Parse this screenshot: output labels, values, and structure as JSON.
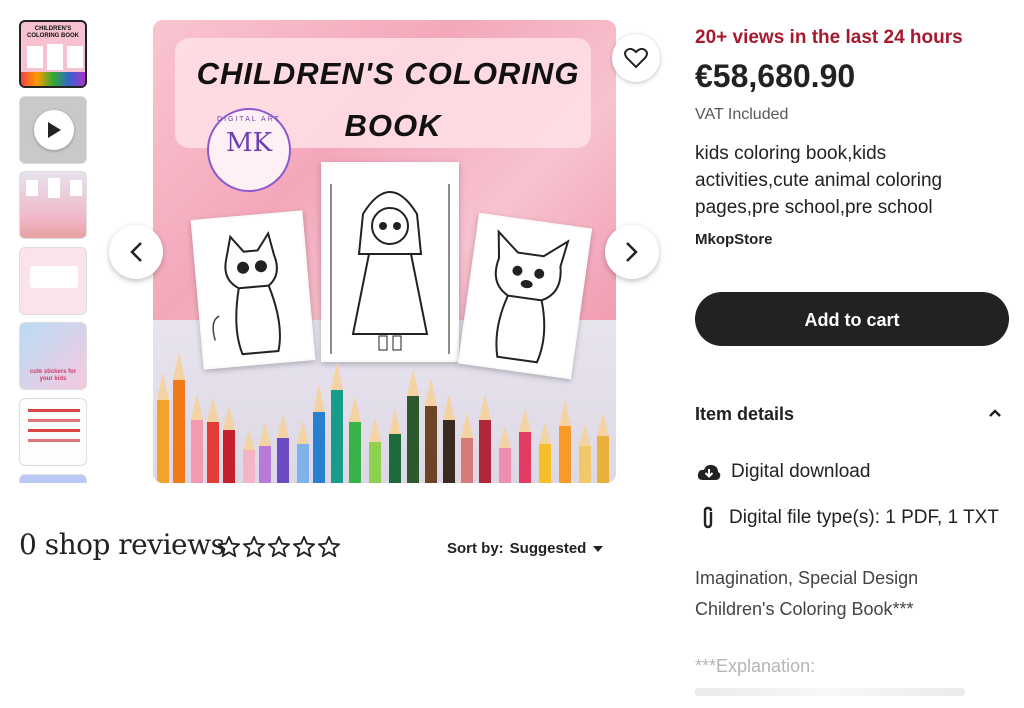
{
  "gallery": {
    "thumb1_title": "CHILDREN'S COLORING BOOK",
    "thumb5_caption": "cute stickers for your kids",
    "hero": {
      "title_line1": "CHILDREN'S COLORING",
      "title_line2": "BOOK",
      "logo_text": "MK",
      "logo_arc": "DIGITAL ART"
    }
  },
  "reviews": {
    "heading": "0 shop reviews",
    "rating": 0,
    "rating_max": 5,
    "sort_label": "Sort by:",
    "sort_value": "Suggested"
  },
  "product": {
    "views_badge": "20+ views in the last 24 hours",
    "price": "€58,680.90",
    "vat": "VAT Included",
    "title": "kids coloring book,kids activities,cute animal coloring pages,pre school,pre school",
    "store": "MkopStore",
    "add_to_cart": "Add to cart"
  },
  "item_details": {
    "heading": "Item details",
    "features": [
      {
        "icon": "cloud-download-icon",
        "label": "Digital download"
      },
      {
        "icon": "paperclip-icon",
        "label": "Digital file type(s): 1 PDF, 1 TXT"
      }
    ],
    "description_line1": "Imagination, Special Design",
    "description_line2": "Children's Coloring Book***",
    "explanation": "***Explanation:"
  },
  "colors": {
    "accent_red": "#a61a2e",
    "button_dark": "#222222",
    "hero_pink": "#f7b8c6"
  }
}
